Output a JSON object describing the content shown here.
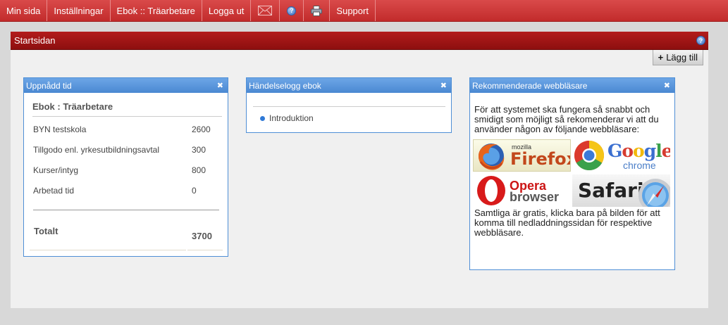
{
  "nav": {
    "items": [
      {
        "label": "Min sida"
      },
      {
        "label": "Inställningar"
      },
      {
        "label": "Ebok :: Träarbetare"
      },
      {
        "label": "Logga ut"
      }
    ],
    "support_label": "Support",
    "icons": [
      "mail-icon",
      "help-icon",
      "print-icon"
    ]
  },
  "panel": {
    "title": "Startsidan",
    "add_label": "Lägg till"
  },
  "widgets": {
    "time": {
      "title": "Uppnådd tid",
      "subtitle": "Ebok : Träarbetare",
      "rows": [
        {
          "label": "BYN testskola",
          "value": "2600"
        },
        {
          "label": "Tillgodo enl. yrkesutbildningsavtal",
          "value": "300"
        },
        {
          "label": "Kurser/intyg",
          "value": "800"
        },
        {
          "label": "Arbetad tid",
          "value": "0"
        }
      ],
      "total_label": "Totalt",
      "total_value": "3700"
    },
    "log": {
      "title": "Händelselogg ebok",
      "items": [
        "Introduktion"
      ]
    },
    "browsers": {
      "title": "Rekommenderade webbläsare",
      "intro": "För att systemet ska fungera så snabbt och smidigt som möjligt så rekomenderar vi att du använder någon av följande webbläsare:",
      "outro": "Samtliga är gratis, klicka bara på bilden för att komma till nedladdningssidan för respektive webbläsare.",
      "logos": {
        "firefox_small": "mozilla",
        "firefox": "Firefox",
        "chrome_word": "Google",
        "chrome_small": "chrome",
        "opera": "Opera",
        "opera_small": "browser",
        "safari": "Safari"
      }
    }
  },
  "colors": {
    "nav_red": "#c22b2b",
    "panel_header": "#a01616",
    "widget_blue": "#4a88d2"
  }
}
